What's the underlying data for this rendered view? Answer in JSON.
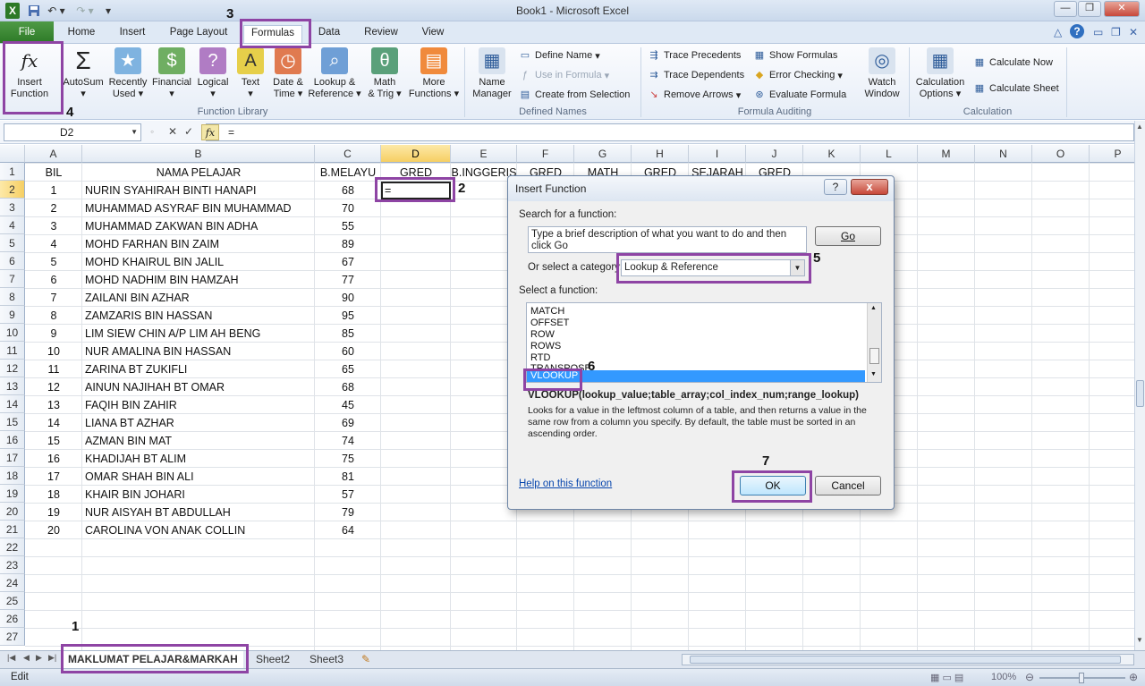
{
  "window": {
    "title": "Book1  -  Microsoft Excel"
  },
  "tabs": [
    "File",
    "Home",
    "Insert",
    "Page Layout",
    "Formulas",
    "Data",
    "Review",
    "View"
  ],
  "ribbon": {
    "insert_function": [
      "Insert",
      "Function"
    ],
    "autosum": "AutoSum",
    "recently_used": [
      "Recently",
      "Used"
    ],
    "financial": "Financial",
    "logical": "Logical",
    "text": "Text",
    "date_time": [
      "Date &",
      "Time"
    ],
    "lookup_reference": [
      "Lookup &",
      "Reference"
    ],
    "math_trig": [
      "Math",
      "& Trig"
    ],
    "more_functions": [
      "More",
      "Functions"
    ],
    "group_function_library": "Function Library",
    "name_manager": [
      "Name",
      "Manager"
    ],
    "define_name": "Define Name",
    "use_in_formula": "Use in Formula",
    "create_from_selection": "Create from Selection",
    "group_defined_names": "Defined Names",
    "trace_precedents": "Trace Precedents",
    "trace_dependents": "Trace Dependents",
    "remove_arrows": "Remove Arrows",
    "show_formulas": "Show Formulas",
    "error_checking": "Error Checking",
    "evaluate_formula": "Evaluate Formula",
    "watch_window": [
      "Watch",
      "Window"
    ],
    "group_formula_auditing": "Formula Auditing",
    "calculation_options": [
      "Calculation",
      "Options"
    ],
    "calculate_now": "Calculate Now",
    "calculate_sheet": "Calculate Sheet",
    "group_calculation": "Calculation"
  },
  "formula_bar": {
    "name_box": "D2",
    "fx": "fx",
    "content": "="
  },
  "columns": [
    "A",
    "B",
    "C",
    "D",
    "E",
    "F",
    "G",
    "H",
    "I",
    "J",
    "K",
    "L",
    "M",
    "N",
    "O",
    "P"
  ],
  "header_row": {
    "A": "BIL",
    "B": "NAMA PELAJAR",
    "C": "B.MELAYU",
    "D": "GRED",
    "E": "B.INGGERIS",
    "F": "GRED",
    "G": "MATH",
    "H": "GRED",
    "I": "SEJARAH",
    "J": "GRED"
  },
  "active_cell_value": "=",
  "rows": [
    {
      "bil": "1",
      "nama": "NURIN SYAHIRAH BINTI HANAPI",
      "bm": "68"
    },
    {
      "bil": "2",
      "nama": "MUHAMMAD ASYRAF BIN MUHAMMAD",
      "bm": "70"
    },
    {
      "bil": "3",
      "nama": "MUHAMMAD ZAKWAN BIN ADHA",
      "bm": "55"
    },
    {
      "bil": "4",
      "nama": "MOHD FARHAN BIN ZAIM",
      "bm": "89"
    },
    {
      "bil": "5",
      "nama": "MOHD KHAIRUL BIN JALIL",
      "bm": "67"
    },
    {
      "bil": "6",
      "nama": "MOHD NADHIM BIN HAMZAH",
      "bm": "77"
    },
    {
      "bil": "7",
      "nama": "ZAILANI BIN AZHAR",
      "bm": "90"
    },
    {
      "bil": "8",
      "nama": "ZAMZARIS BIN HASSAN",
      "bm": "95"
    },
    {
      "bil": "9",
      "nama": "LIM SIEW CHIN A/P LIM AH BENG",
      "bm": "85"
    },
    {
      "bil": "10",
      "nama": "NUR AMALINA BIN HASSAN",
      "bm": "60"
    },
    {
      "bil": "11",
      "nama": "ZARINA BT ZUKIFLI",
      "bm": "65"
    },
    {
      "bil": "12",
      "nama": "AINUN NAJIHAH BT OMAR",
      "bm": "68"
    },
    {
      "bil": "13",
      "nama": "FAQIH BIN ZAHIR",
      "bm": "45"
    },
    {
      "bil": "14",
      "nama": "LIANA BT AZHAR",
      "bm": "69"
    },
    {
      "bil": "15",
      "nama": "AZMAN BIN MAT",
      "bm": "74"
    },
    {
      "bil": "16",
      "nama": "KHADIJAH BT ALIM",
      "bm": "75"
    },
    {
      "bil": "17",
      "nama": "OMAR SHAH BIN ALI",
      "bm": "81"
    },
    {
      "bil": "18",
      "nama": "KHAIR BIN JOHARI",
      "bm": "57"
    },
    {
      "bil": "19",
      "nama": "NUR AISYAH BT ABDULLAH",
      "bm": "79"
    },
    {
      "bil": "20",
      "nama": "CAROLINA VON ANAK COLLIN",
      "bm": "64"
    }
  ],
  "row_numbers": [
    "1",
    "2",
    "3",
    "4",
    "5",
    "6",
    "7",
    "8",
    "9",
    "10",
    "11",
    "12",
    "13",
    "14",
    "15",
    "16",
    "17",
    "18",
    "19",
    "20",
    "21",
    "22",
    "23",
    "24",
    "25",
    "26",
    "27"
  ],
  "sheets": [
    "MAKLUMAT PELAJAR&MARKAH",
    "Sheet2",
    "Sheet3"
  ],
  "status": {
    "mode": "Edit",
    "zoom": "100%"
  },
  "dialog": {
    "title": "Insert Function",
    "help_button": "?",
    "close_button": "x",
    "search_label": "Search for a function:",
    "search_text": "Type a brief description of what you want to do and then click Go",
    "go_button": "Go",
    "category_label": "Or select a category:",
    "category_value": "Lookup & Reference",
    "select_label": "Select a function:",
    "functions": [
      "MATCH",
      "OFFSET",
      "ROW",
      "ROWS",
      "RTD",
      "TRANSPOSE",
      "VLOOKUP"
    ],
    "selected_function": "VLOOKUP",
    "signature": "VLOOKUP(lookup_value;table_array;col_index_num;range_lookup)",
    "description": "Looks for a value in the leftmost column of a table, and then returns a value in the same row from a column you specify. By default, the table must be sorted in an ascending order.",
    "help_link": "Help on this function",
    "ok_button": "OK",
    "cancel_button": "Cancel"
  },
  "annotations": [
    "1",
    "2",
    "3",
    "4",
    "5",
    "6",
    "7"
  ],
  "colors": {
    "highlight": "#8e44a4",
    "selection": "#3399ff",
    "file_tab": "#3a8a33"
  }
}
